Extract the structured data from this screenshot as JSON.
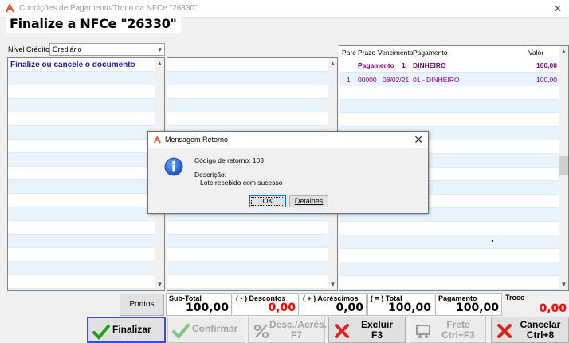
{
  "window": {
    "title": "Condições de Pagamento/Troco da NFCe \"26330\"",
    "close_glyph": "✕"
  },
  "heading": "Finalize a NFCe \"26330\"",
  "nivel_credito": {
    "label": "Nível Crédito",
    "value": "Crediário"
  },
  "grid_left": {
    "title": "Finalize ou cancele o documento"
  },
  "payments": {
    "headers": [
      "Parc",
      "Prazo",
      "Vencimento",
      "Pagamento",
      "Valor"
    ],
    "summary": {
      "label": "Pagamento",
      "number": "1",
      "method": "DINHEIRO",
      "value": "100,00"
    },
    "rows": [
      {
        "parc": "1",
        "prazo": "00000",
        "vencimento": "08/02/21",
        "pagamento": "01 - DINHEIRO",
        "valor": "100,00"
      }
    ]
  },
  "pontos_label": "Pontos",
  "totals": [
    {
      "label": "Sub-Total",
      "value": "100,00",
      "color": "#000000"
    },
    {
      "label": "( - ) Descontos",
      "value": "0,00",
      "color": "#ff0000"
    },
    {
      "label": "( + ) Acréscimos",
      "value": "0,00",
      "color": "#000000"
    },
    {
      "label": "( = ) Total",
      "value": "100,00",
      "color": "#000000"
    },
    {
      "label": "Pagamento",
      "value": "100,00",
      "color": "#000000"
    },
    {
      "label": "Troco",
      "value": "0,00",
      "color": "#ff0000"
    }
  ],
  "buttons": {
    "finalizar": "Finalizar",
    "confirmar": "Confirmar",
    "desc": "Desc./Acrés.\nF7",
    "excluir": "Excluir\nF3",
    "frete": "Frete\nCtrl+F3",
    "cancelar": "Cancelar\nCtrl+8"
  },
  "dialog": {
    "title": "Mensagem Retorno",
    "code_line": "Código de retorno: 103",
    "desc_label": "Descrição:",
    "desc_text": "Lote recebido com sucesso",
    "ok": "OK",
    "details": "Detalhes",
    "close_glyph": "✕"
  },
  "colors": {
    "accent_blue": "#1e1ea0",
    "purple_text": "#800080",
    "red": "#ff0000",
    "green_check": "#1e9e1e",
    "cancel_red": "#e02020"
  }
}
